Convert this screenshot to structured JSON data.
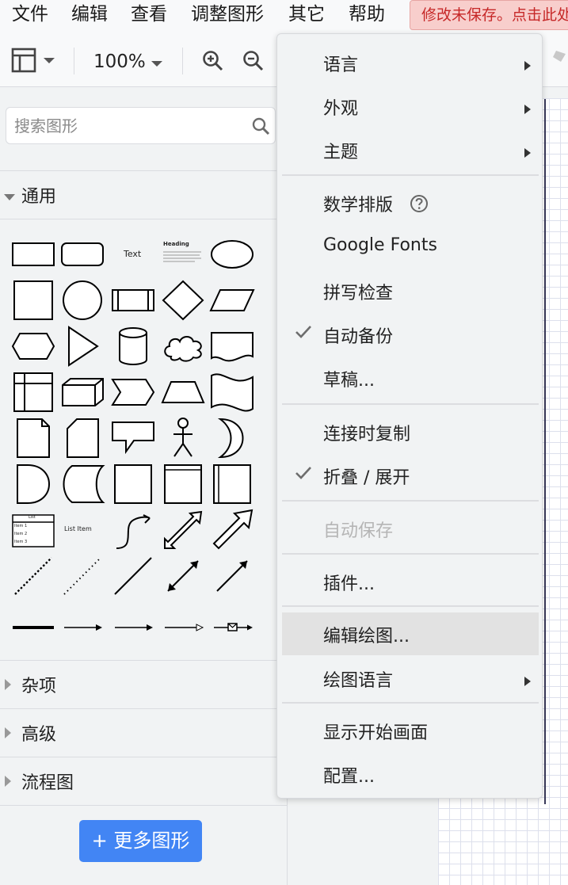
{
  "menubar": {
    "items": [
      "文件",
      "编辑",
      "查看",
      "调整图形",
      "其它",
      "帮助"
    ],
    "unsaved_notice": "修改未保存。点击此处以保存。"
  },
  "toolbar": {
    "zoom": "100%"
  },
  "sidebar": {
    "search_placeholder": "搜索图形",
    "sections": {
      "general": "通用",
      "misc": "杂项",
      "advanced": "高级",
      "flowchart": "流程图"
    },
    "shape_texts": {
      "text": "Text",
      "heading": "Heading",
      "list": "List",
      "item1": "Item 1",
      "item2": "Item 2",
      "item3": "Item 3",
      "list_item": "List Item"
    },
    "more_shapes": "+ 更多图形"
  },
  "dropdown": {
    "items": [
      {
        "label": "语言",
        "submenu": true
      },
      {
        "label": "外观",
        "submenu": true
      },
      {
        "label": "主题",
        "submenu": true
      },
      {
        "label": "数学排版",
        "help": true
      },
      {
        "label": "Google Fonts"
      },
      {
        "label": "拼写检查"
      },
      {
        "label": "自动备份",
        "checked": true
      },
      {
        "label": "草稿..."
      },
      {
        "label": "连接时复制"
      },
      {
        "label": "折叠 / 展开",
        "checked": true
      },
      {
        "label": "自动保存",
        "disabled": true
      },
      {
        "label": "插件..."
      },
      {
        "label": "编辑绘图...",
        "highlighted": true
      },
      {
        "label": "绘图语言",
        "submenu": true
      },
      {
        "label": "显示开始画面"
      },
      {
        "label": "配置..."
      }
    ]
  },
  "colors": {
    "accent": "#4285f4",
    "unsaved_bg": "#f8cecc",
    "unsaved_text": "#c62828"
  }
}
